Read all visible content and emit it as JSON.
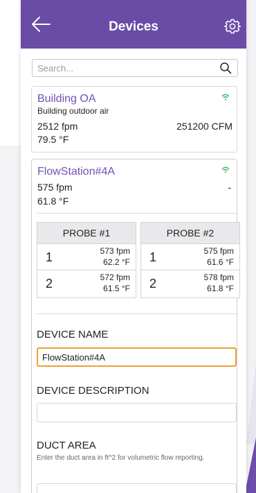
{
  "header": {
    "title": "Devices"
  },
  "search": {
    "placeholder": "Search..."
  },
  "devices": [
    {
      "name": "Building OA",
      "description": "Building outdoor air",
      "velocity": "2512 fpm",
      "flow": "251200 CFM",
      "temp": "79.5 °F"
    },
    {
      "name": "FlowStation#4A",
      "velocity": "575 fpm",
      "flow": "-",
      "temp": "61.8 °F"
    }
  ],
  "probes": [
    {
      "label": "PROBE #1",
      "rows": [
        {
          "idx": "1",
          "velocity": "573  fpm",
          "temp": "62.2  °F"
        },
        {
          "idx": "2",
          "velocity": "572  fpm",
          "temp": "61.5  °F"
        }
      ]
    },
    {
      "label": "PROBE #2",
      "rows": [
        {
          "idx": "1",
          "velocity": "575  fpm",
          "temp": "61.6  °F"
        },
        {
          "idx": "2",
          "velocity": "578  fpm",
          "temp": "61.8  °F"
        }
      ]
    }
  ],
  "form": {
    "device_name_label": "DEVICE NAME",
    "device_name_value": "FlowStation#4A",
    "device_description_label": "DEVICE DESCRIPTION",
    "device_description_value": "",
    "duct_area_label": "DUCT AREA",
    "duct_area_hint": "Enter the duct area in ft^2 for volumetric flow reporting."
  },
  "colors": {
    "header": "#6a4ba6",
    "accent": "#7052b0",
    "focus": "#f0a030",
    "signal": "#2bb24c"
  }
}
